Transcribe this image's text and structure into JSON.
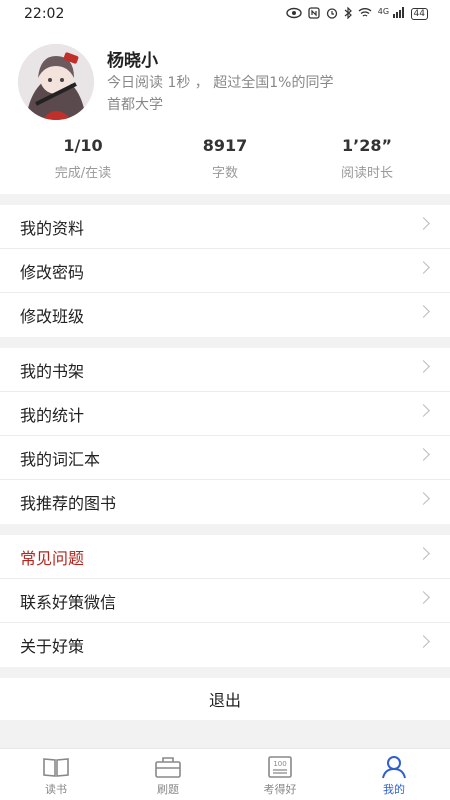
{
  "status_bar": {
    "time": "22:02",
    "network": "4G",
    "battery": "44"
  },
  "profile": {
    "name": "杨晓小",
    "reading_today": "今日阅读 1秒 ，  超过全国1%的同学",
    "school": "首都大学"
  },
  "stats": [
    {
      "value": "1/10",
      "label": "完成/在读"
    },
    {
      "value": "8917",
      "label": "字数"
    },
    {
      "value": "1’28”",
      "label": "阅读时长"
    }
  ],
  "menu": {
    "group1": [
      "我的资料",
      "修改密码",
      "修改班级"
    ],
    "group2": [
      "我的书架",
      "我的统计",
      "我的词汇本",
      "我推荐的图书"
    ],
    "group3": [
      "常见问题",
      "联系好策微信",
      "关于好策"
    ]
  },
  "logout_label": "退出",
  "tabs": [
    {
      "label": "读书",
      "icon": "book-icon"
    },
    {
      "label": "刷题",
      "icon": "exercise-icon"
    },
    {
      "label": "考得好",
      "icon": "score-icon",
      "badge": "100"
    },
    {
      "label": "我的",
      "icon": "user-icon"
    }
  ],
  "colors": {
    "accent": "#2f5fd0",
    "highlight": "#b3261e"
  }
}
